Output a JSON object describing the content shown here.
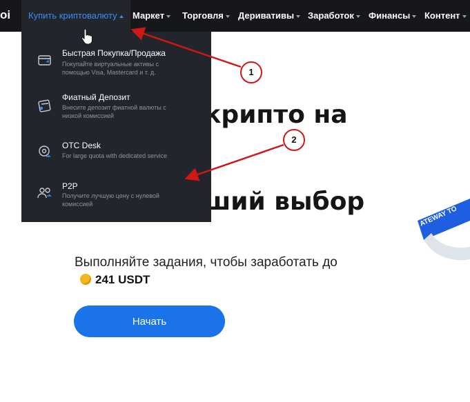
{
  "nav": {
    "logo_fragment": "oi",
    "active_item": "Купить криптовалюту",
    "items": [
      "Маркет",
      "Торговля",
      "Деривативы",
      "Заработок",
      "Финансы",
      "Контент"
    ]
  },
  "dropdown": {
    "items": [
      {
        "title": "Быстрая Покупка/Продажа",
        "desc": "Покупайте виртуальные активы с помощью Visa, Mastercard и т. д.",
        "icon": "card-icon"
      },
      {
        "title": "Фиатный Депозит",
        "desc": "Внесите депозит фиатной валюты с низкой комиссией",
        "icon": "fiat-deposit-icon"
      },
      {
        "title": "OTC Desk",
        "desc": "For large quota with dedicated service",
        "icon": "otc-icon"
      },
      {
        "title": "P2P",
        "desc": "Получите лучшую цену с нулевой комиссией",
        "icon": "users-icon"
      }
    ]
  },
  "hero": {
    "line1": "крипто на",
    "line2": "ший выбор",
    "subtitle": "Выполняйте задания, чтобы заработать до",
    "reward": "241 USDT",
    "cta": "Начать",
    "band_text": "ATEWAY TO"
  },
  "annotations": {
    "marker1": "1",
    "marker2": "2",
    "accent": "#d11616"
  }
}
